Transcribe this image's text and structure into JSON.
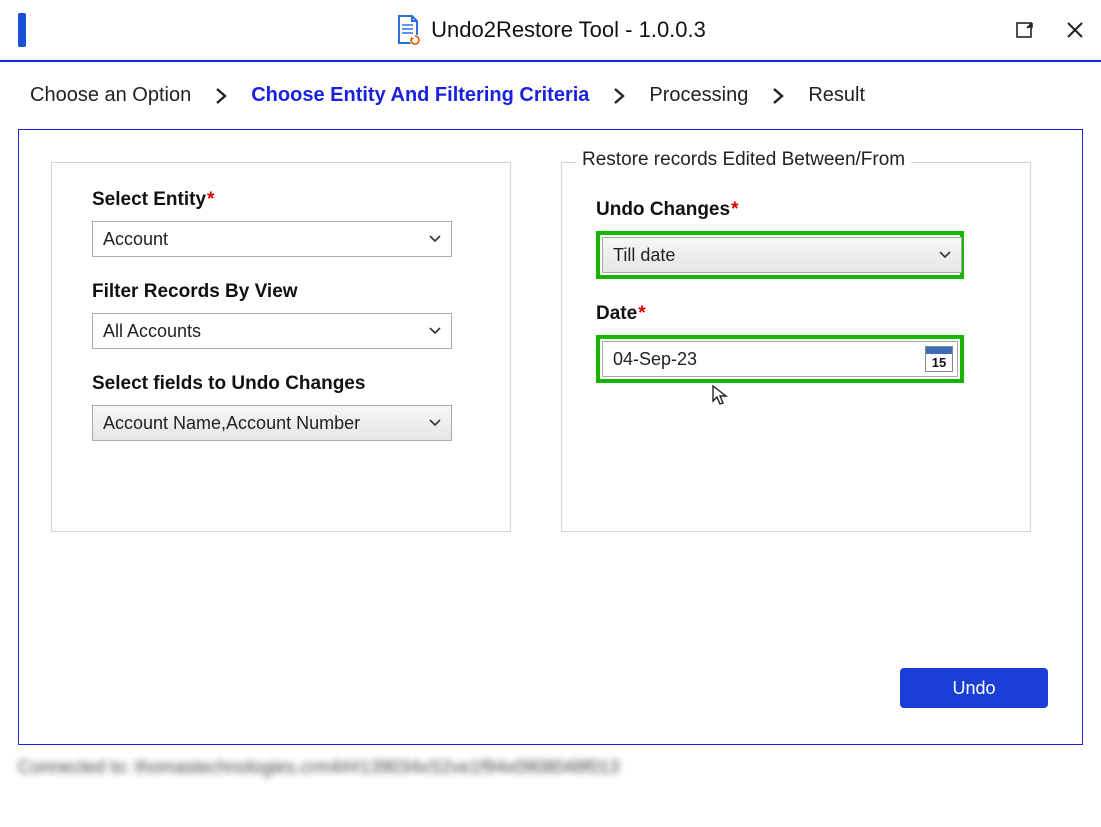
{
  "title": "Undo2Restore Tool - 1.0.0.3",
  "breadcrumb": {
    "step1": "Choose an Option",
    "step2": "Choose Entity And Filtering Criteria",
    "step3": "Processing",
    "step4": "Result"
  },
  "left": {
    "entity_label": "Select Entity",
    "entity_value": "Account",
    "view_label": "Filter Records By View",
    "view_value": "All Accounts",
    "fields_label": "Select fields to Undo Changes",
    "fields_value": "Account Name,Account Number"
  },
  "right": {
    "legend": "Restore records Edited Between/From",
    "undo_changes_label": "Undo Changes",
    "undo_changes_value": "Till date",
    "date_label": "Date",
    "date_value": "04-Sep-23",
    "calendar_day": "15"
  },
  "undo_button": "Undo",
  "status": "Connected to: thomastechnologies.crm4##139034xS2ve1f94x0908048f013"
}
